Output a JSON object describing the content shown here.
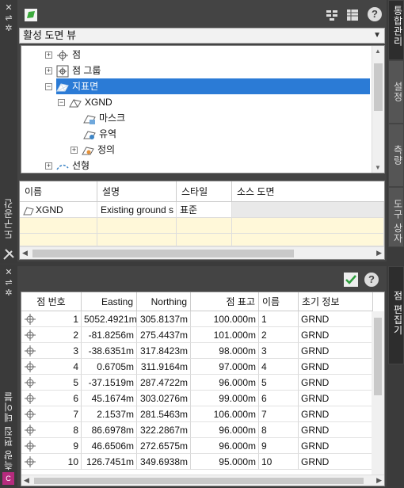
{
  "toolspace": {
    "side_title": "도구공간",
    "view_select": "활성 도면 뷰",
    "tree": [
      {
        "label": "점",
        "icon": "point-icon"
      },
      {
        "label": "점 그룹",
        "icon": "point-group-icon"
      },
      {
        "label": "지표면",
        "icon": "surfaces-icon"
      },
      {
        "label": "XGND",
        "icon": "surface-icon"
      },
      {
        "label": "마스크",
        "icon": "mask-icon"
      },
      {
        "label": "유역",
        "icon": "watershed-icon"
      },
      {
        "label": "정의",
        "icon": "definition-icon"
      },
      {
        "label": "선형",
        "icon": "alignment-icon"
      }
    ],
    "list": {
      "headers": [
        "이름",
        "설명",
        "스타일",
        "소스 도면"
      ],
      "rows": [
        {
          "name": "XGND",
          "description": "Existing ground s",
          "style": "표준",
          "source": ""
        }
      ]
    },
    "right_tabs": [
      "통합관리",
      "설정",
      "측량",
      "도구 상자"
    ]
  },
  "editor": {
    "side_title": "측량 편집 테이블",
    "right_tab": "점 편집기",
    "headers": [
      "점 번호",
      "Easting",
      "Northing",
      "점 표고",
      "이름",
      "초기 정보"
    ],
    "rows": [
      [
        "1",
        "5052.4921m",
        "305.8137m",
        "100.000m",
        "1",
        "GRND"
      ],
      [
        "2",
        "-81.8256m",
        "275.4437m",
        "101.000m",
        "2",
        "GRND"
      ],
      [
        "3",
        "-38.6351m",
        "317.8423m",
        "98.000m",
        "3",
        "GRND"
      ],
      [
        "4",
        "0.6705m",
        "311.9164m",
        "97.000m",
        "4",
        "GRND"
      ],
      [
        "5",
        "-37.1519m",
        "287.4722m",
        "96.000m",
        "5",
        "GRND"
      ],
      [
        "6",
        "45.1674m",
        "303.0276m",
        "99.000m",
        "6",
        "GRND"
      ],
      [
        "7",
        "2.1537m",
        "281.5463m",
        "106.000m",
        "7",
        "GRND"
      ],
      [
        "8",
        "86.6978m",
        "322.2867m",
        "96.000m",
        "8",
        "GRND"
      ],
      [
        "9",
        "46.6506m",
        "272.6575m",
        "96.000m",
        "9",
        "GRND"
      ],
      [
        "10",
        "126.7451m",
        "349.6938m",
        "95.000m",
        "10",
        "GRND"
      ]
    ]
  }
}
